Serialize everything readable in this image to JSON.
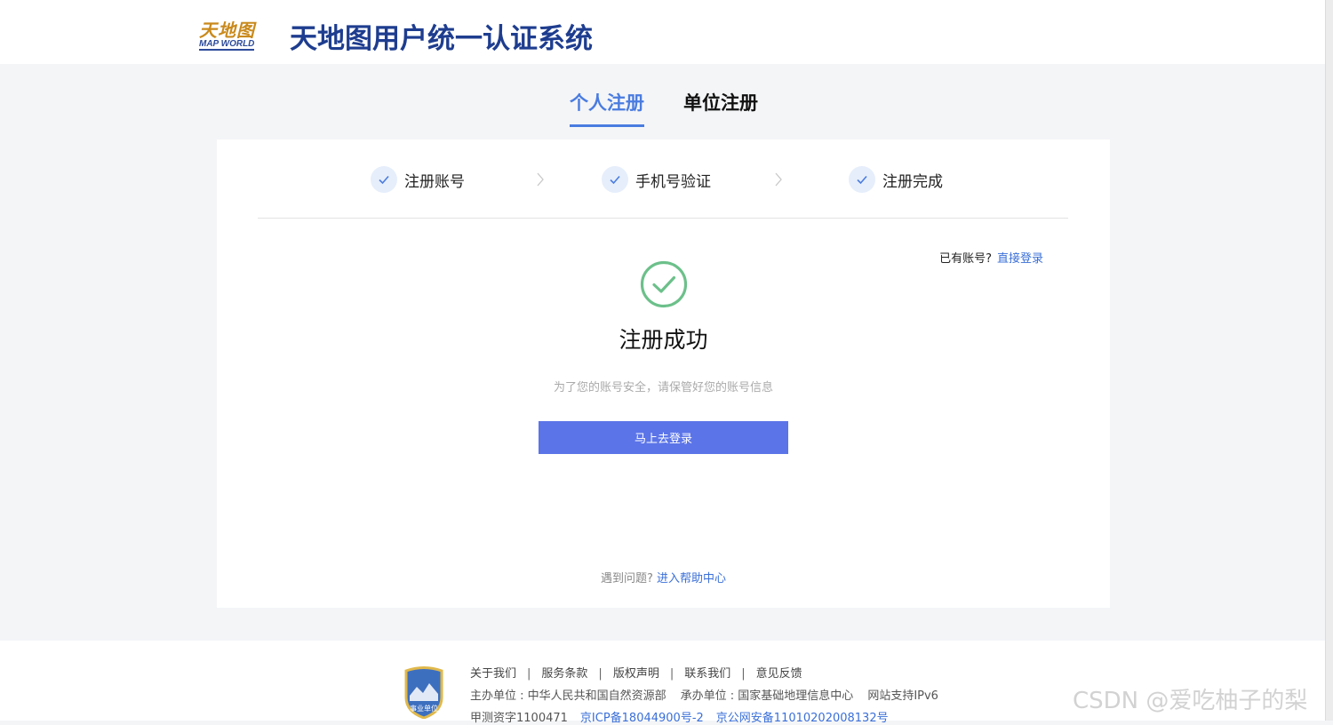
{
  "header": {
    "logo_cn": "天地图",
    "logo_en": "MAP WORLD",
    "title": "天地图用户统一认证系统"
  },
  "tabs": [
    {
      "label": "个人注册",
      "active": true
    },
    {
      "label": "单位注册",
      "active": false
    }
  ],
  "steps": [
    {
      "label": "注册账号",
      "icon": "check-icon"
    },
    {
      "label": "手机号验证",
      "icon": "check-icon"
    },
    {
      "label": "注册完成",
      "icon": "check-icon"
    }
  ],
  "login_hint": {
    "text": "已有账号?",
    "link": "直接登录"
  },
  "result": {
    "title": "注册成功",
    "subtitle": "为了您的账号安全，请保管好您的账号信息",
    "button": "马上去登录"
  },
  "help": {
    "text": "遇到问题?",
    "link": "进入帮助中心"
  },
  "footer": {
    "badge_text": "事业单位",
    "links": [
      "关于我们",
      "服务条款",
      "版权声明",
      "联系我们",
      "意见反馈"
    ],
    "separator": "|",
    "host": "主办单位 : 中华人民共和国自然资源部",
    "organizer": "承办单位 : 国家基础地理信息中心",
    "ipv6": "网站支持IPv6",
    "survey_license": "甲测资字1100471",
    "icp": "京ICP备18044900号-2",
    "police": "京公网安备11010202008132号"
  },
  "watermark": "CSDN @爱吃柚子的梨",
  "colors": {
    "accent": "#4a7ce0",
    "button": "#5b74e8",
    "success": "#6cc08a",
    "title": "#1e3d8f",
    "link": "#3a6fd8"
  }
}
